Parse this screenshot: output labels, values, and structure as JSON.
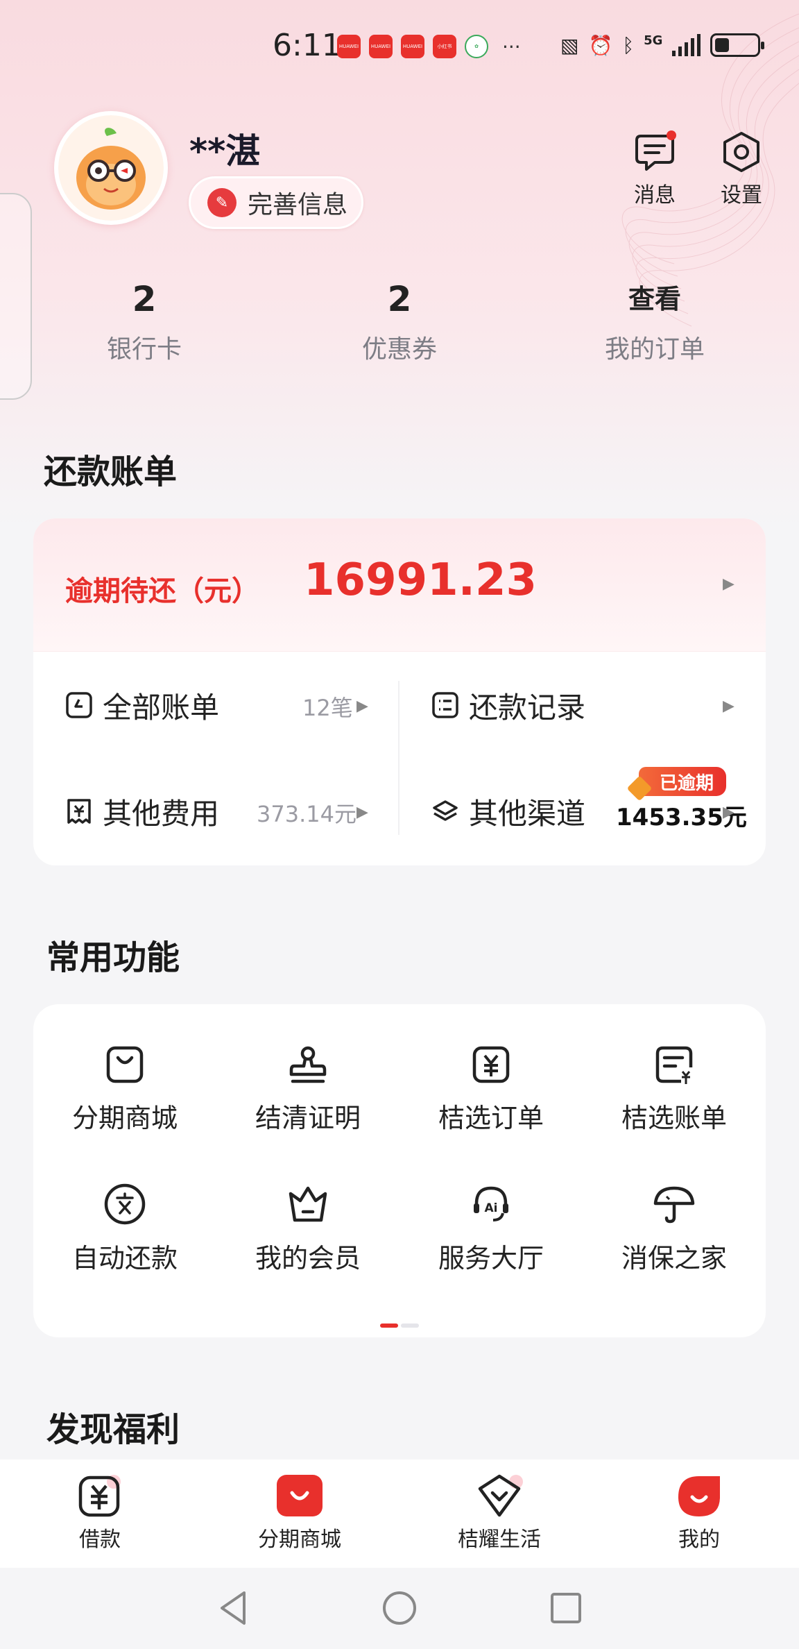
{
  "status_bar": {
    "time": "6:11",
    "apps": [
      "HUAWEI",
      "HUAWEI",
      "HUAWEI",
      "小红书"
    ],
    "more": "···",
    "network": "5G",
    "icons": [
      "nfc-icon",
      "alarm-icon",
      "bluetooth-icon",
      "signal-icon",
      "battery-icon"
    ]
  },
  "profile": {
    "name": "**湛",
    "complete_info_label": "完善信息",
    "messages_label": "消息",
    "settings_label": "设置"
  },
  "stats": [
    {
      "value": "2",
      "label": "银行卡"
    },
    {
      "value": "2",
      "label": "优惠券"
    },
    {
      "value": "查看",
      "label": "我的订单"
    }
  ],
  "repayment": {
    "section_title": "还款账单",
    "overdue_label": "逾期待还（元）",
    "overdue_amount": "16991.23",
    "all_bills_label": "全部账单",
    "all_bills_count": "12笔",
    "records_label": "还款记录",
    "other_fees_label": "其他费用",
    "other_fees_amount": "373.14元",
    "other_channels_label": "其他渠道",
    "other_channels_amount": "1453.35元",
    "overdue_tag": "已逾期"
  },
  "features": {
    "section_title": "常用功能",
    "items": [
      {
        "label": "分期商城",
        "icon": "shopping-bag-icon"
      },
      {
        "label": "结清证明",
        "icon": "stamp-icon"
      },
      {
        "label": "桔选订单",
        "icon": "yuan-order-icon"
      },
      {
        "label": "桔选账单",
        "icon": "bill-icon"
      },
      {
        "label": "自动还款",
        "icon": "auto-pay-icon"
      },
      {
        "label": "我的会员",
        "icon": "crown-icon"
      },
      {
        "label": "服务大厅",
        "icon": "ai-service-icon"
      },
      {
        "label": "消保之家",
        "icon": "umbrella-icon"
      }
    ]
  },
  "discover": {
    "section_title": "发现福利"
  },
  "bottom_nav": [
    {
      "label": "借款",
      "icon": "loan-icon"
    },
    {
      "label": "分期商城",
      "icon": "mall-icon"
    },
    {
      "label": "桔耀生活",
      "icon": "life-icon"
    },
    {
      "label": "我的",
      "icon": "mine-icon",
      "active": true
    }
  ],
  "colors": {
    "accent": "#e8302c",
    "muted": "#9b9ba3"
  }
}
